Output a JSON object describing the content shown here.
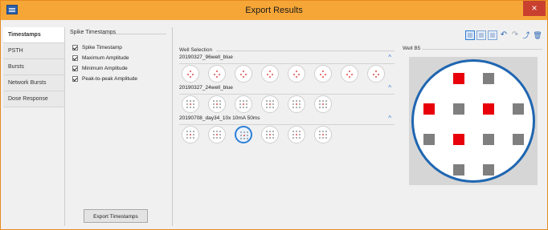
{
  "window": {
    "title": "Export Results",
    "close_glyph": "×"
  },
  "tabs": [
    "Timestamps",
    "PSTH",
    "Bursts",
    "Network Bursts",
    "Dose Response"
  ],
  "active_tab": "Timestamps",
  "spike_timestamps": {
    "group_label": "Spike Timestamps",
    "options": [
      {
        "label": "Spike Timestamp",
        "checked": true
      },
      {
        "label": "Maximum Amplitude",
        "checked": true
      },
      {
        "label": "Minimum Amplitude",
        "checked": true
      },
      {
        "label": "Peak-to-peak Amplitude",
        "checked": true
      }
    ],
    "export_button": "Export Timestamps"
  },
  "toolbar": {
    "icons": [
      "grid-view-icon",
      "grid-view-icon",
      "grid-view-icon",
      "undo-icon",
      "redo-icon",
      "export-icon",
      "delete-icon"
    ]
  },
  "well_selection": {
    "label": "Well Selection",
    "plates": [
      {
        "name": "20190327_96well_blue",
        "wells": 8,
        "layout": "cross"
      },
      {
        "name": "20190327_24well_blue",
        "wells": 6,
        "layout": "grid"
      },
      {
        "name": "20190708_day34_10x 10mA 50ms",
        "wells": 6,
        "layout": "grid",
        "selected_index": 2
      }
    ]
  },
  "well_bs": {
    "label": "Well B5",
    "colors": {
      "active": "#e8000b",
      "inactive": "#7f7f7f",
      "ring": "#1f66b1"
    },
    "electrodes": [
      [
        null,
        "active",
        "inactive",
        null
      ],
      [
        "active",
        "inactive",
        "active",
        "inactive"
      ],
      [
        "inactive",
        "active",
        "inactive",
        "inactive"
      ],
      [
        null,
        "inactive",
        "inactive",
        null
      ]
    ]
  }
}
